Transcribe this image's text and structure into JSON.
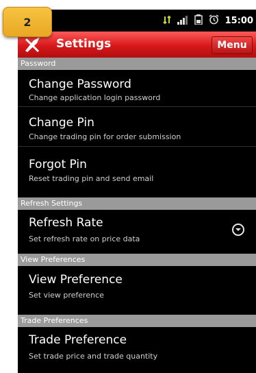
{
  "step_badge": "2",
  "status_bar": {
    "time": "15:00"
  },
  "title_bar": {
    "title": "Settings",
    "menu_label": "Menu"
  },
  "sections": {
    "password": {
      "header": "Password",
      "items": [
        {
          "title": "Change Password",
          "subtitle": "Change application login password"
        },
        {
          "title": "Change Pin",
          "subtitle": "Change trading pin for order submission"
        },
        {
          "title": "Forgot Pin",
          "subtitle": "Reset trading pin and send email"
        }
      ]
    },
    "refresh": {
      "header": "Refresh Settings",
      "items": [
        {
          "title": "Refresh Rate",
          "subtitle": "Set refresh rate on price data"
        }
      ]
    },
    "view": {
      "header": "View Preferences",
      "items": [
        {
          "title": "View Preference",
          "subtitle": "Set view preference"
        }
      ]
    },
    "trade": {
      "header": "Trade Preferences",
      "items": [
        {
          "title": "Trade Preference",
          "subtitle": "Set trade price and trade quantity"
        }
      ]
    }
  },
  "colors": {
    "title_bar": "#d7181a",
    "section_header": "#9a9a9a",
    "badge": "#f0b532"
  }
}
